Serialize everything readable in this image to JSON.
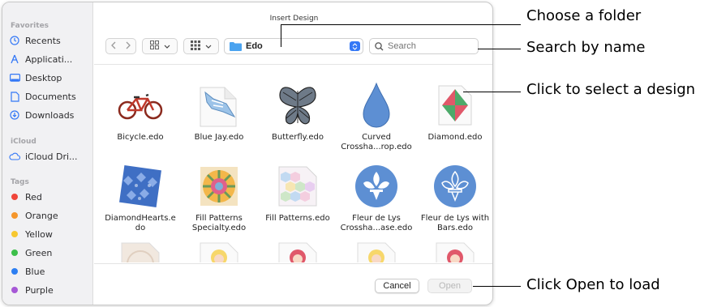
{
  "dialog": {
    "title": "Insert Design",
    "sidebar": {
      "favorites_header": "Favorites",
      "favorites": [
        {
          "label": "Recents",
          "icon": "clock-icon"
        },
        {
          "label": "Applicati...",
          "icon": "applications-icon"
        },
        {
          "label": "Desktop",
          "icon": "desktop-icon"
        },
        {
          "label": "Documents",
          "icon": "document-icon"
        },
        {
          "label": "Downloads",
          "icon": "download-icon"
        }
      ],
      "icloud_header": "iCloud",
      "icloud": [
        {
          "label": "iCloud Dri...",
          "icon": "cloud-icon"
        }
      ],
      "tags_header": "Tags",
      "tags": [
        {
          "label": "Red",
          "color": "#f0453a"
        },
        {
          "label": "Orange",
          "color": "#f5962c"
        },
        {
          "label": "Yellow",
          "color": "#f7c830"
        },
        {
          "label": "Green",
          "color": "#3cbf4a"
        },
        {
          "label": "Blue",
          "color": "#2d7ff2"
        },
        {
          "label": "Purple",
          "color": "#a658d6"
        }
      ]
    },
    "toolbar": {
      "folder": "Edo",
      "search_placeholder": "Search"
    },
    "files": [
      {
        "name": "Bicycle.edo"
      },
      {
        "name": "Blue Jay.edo"
      },
      {
        "name": "Butterfly.edo"
      },
      {
        "name": "Curved\nCrossha...rop.edo"
      },
      {
        "name": "Diamond.edo"
      },
      {
        "name": "DiamondHearts.e\ndo"
      },
      {
        "name": "Fill Patterns\nSpecialty.edo"
      },
      {
        "name": "Fill Patterns.edo"
      },
      {
        "name": "Fleur de Lys\nCrossha...ase.edo"
      },
      {
        "name": "Fleur de Lys with\nBars.edo"
      }
    ],
    "buttons": {
      "cancel": "Cancel",
      "open": "Open"
    }
  },
  "callouts": {
    "folder": "Choose a folder",
    "search": "Search by name",
    "select": "Click to select a design",
    "open": "Click Open to load"
  },
  "colors": {
    "accent": "#3478f6",
    "folder": "#4aa3f0"
  }
}
